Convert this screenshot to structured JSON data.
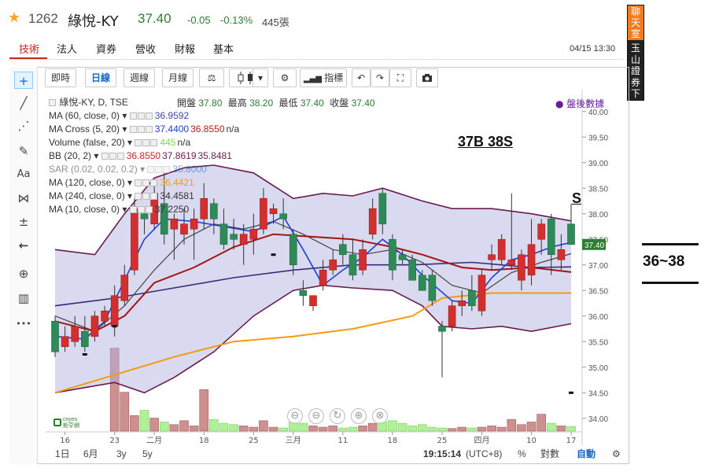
{
  "header": {
    "star": "★",
    "code": "1262",
    "name": "綠悅-KY",
    "price": "37.40",
    "change": "-0.05",
    "change_pct": "-0.13%",
    "volume": "445張"
  },
  "tabs": [
    "技術",
    "法人",
    "資券",
    "營收",
    "財報",
    "基本"
  ],
  "datetime": "04/15 13:30",
  "side_button": {
    "top": "聊天室",
    "bottom": "玉山證券下單"
  },
  "left_tools": [
    "+",
    "╱",
    "⋰",
    "✎",
    "Aa",
    "⋈",
    "±",
    "←",
    "⊕",
    "▥",
    "•••"
  ],
  "toolbar": {
    "intraday": "即時",
    "daily": "日線",
    "weekly": "週線",
    "monthly": "月線",
    "scale_icon": "⚖",
    "candle_icon": "candlestick-icon",
    "dropdown": "▾",
    "gear": "⚙",
    "indicator": "指標",
    "undo": "↶",
    "redo": "↷",
    "fullscreen": "⛶",
    "camera": "camera-icon"
  },
  "ohlc": {
    "open_label": "開盤",
    "open": "37.80",
    "high_label": "最高",
    "high": "38.20",
    "low_label": "最低",
    "low": "37.40",
    "close_label": "收盤",
    "close": "37.40"
  },
  "symbol_line": "綠悅-KY, D, TSE",
  "after_hours": "● 盤後數據",
  "legend": [
    {
      "name": "MA (60, close, 0)",
      "values": [
        "36.9592"
      ],
      "colors": [
        "#3949ab"
      ]
    },
    {
      "name": "MA Cross (5, 20)",
      "values": [
        "37.4400",
        "36.8550",
        "n/a"
      ],
      "colors": [
        "#1e3fd1",
        "#b71c1c",
        "#333333"
      ]
    },
    {
      "name": "Volume (false, 20)",
      "values": [
        "445",
        "n/a"
      ],
      "colors": [
        "#7ed957",
        "#333333"
      ]
    },
    {
      "name": "BB (20, 2)",
      "values": [
        "36.8550",
        "37.8619",
        "35.8481"
      ],
      "colors": [
        "#c62828",
        "#6a1b4d",
        "#6a1b4d"
      ]
    },
    {
      "name": "SAR (0.02, 0.02, 0.2)",
      "values": [
        "35.8000"
      ],
      "colors": [
        "#1565c0"
      ]
    },
    {
      "name": "MA (120, close, 0)",
      "values": [
        "36.4421"
      ],
      "colors": [
        "#f39c12"
      ]
    },
    {
      "name": "MA (240, close, 0)",
      "values": [
        "34.4581"
      ],
      "colors": [
        "#333333"
      ]
    },
    {
      "name": "MA (10, close, 0)",
      "values": [
        "37.2250"
      ],
      "colors": [
        "#333333"
      ]
    }
  ],
  "annotations": {
    "signal": "37B  38S",
    "sell": "S",
    "range": "36~38"
  },
  "zoom_controls": [
    "⊖",
    "⊖",
    "↻",
    "⊕",
    "⊗"
  ],
  "logo_text": "cnyes 鉅亨網",
  "bottom_bar": {
    "ranges": [
      "1日",
      "6月",
      "3y",
      "5y"
    ],
    "time": "19:15:14",
    "tz": "(UTC+8)",
    "pct": "%",
    "log": "對數",
    "auto": "自動",
    "gear": "⚙"
  },
  "chart_data": {
    "type": "candlestick",
    "y_ticks": [
      "40.00",
      "39.50",
      "39.00",
      "38.50",
      "38.00",
      "37.50",
      "37.00",
      "36.50",
      "36.00",
      "35.50",
      "35.00",
      "34.50",
      "34.00"
    ],
    "ylim": [
      33.75,
      40.15
    ],
    "last_price_label": "37.40",
    "x_ticks": [
      {
        "i": 1,
        "label": "16"
      },
      {
        "i": 6,
        "label": "23"
      },
      {
        "i": 10,
        "label": "二月"
      },
      {
        "i": 15,
        "label": "18"
      },
      {
        "i": 20,
        "label": "25"
      },
      {
        "i": 24,
        "label": "三月"
      },
      {
        "i": 29,
        "label": "11"
      },
      {
        "i": 34,
        "label": "18"
      },
      {
        "i": 39,
        "label": "25"
      },
      {
        "i": 43,
        "label": "四月"
      },
      {
        "i": 48,
        "label": "10"
      },
      {
        "i": 52,
        "label": "17"
      }
    ],
    "n_slots": 53,
    "candles": [
      {
        "i": 0,
        "o": 35.9,
        "h": 36.0,
        "l": 35.2,
        "c": 35.3
      },
      {
        "i": 1,
        "o": 35.4,
        "h": 35.8,
        "l": 35.3,
        "c": 35.6
      },
      {
        "i": 2,
        "o": 35.5,
        "h": 36.0,
        "l": 35.4,
        "c": 35.8
      },
      {
        "i": 3,
        "o": 35.7,
        "h": 36.0,
        "l": 35.3,
        "c": 35.4
      },
      {
        "i": 4,
        "o": 35.6,
        "h": 36.1,
        "l": 35.5,
        "c": 36.0
      },
      {
        "i": 5,
        "o": 35.9,
        "h": 36.2,
        "l": 35.8,
        "c": 36.1
      },
      {
        "i": 6,
        "o": 35.8,
        "h": 36.6,
        "l": 35.6,
        "c": 36.4
      },
      {
        "i": 7,
        "o": 36.3,
        "h": 37.0,
        "l": 36.2,
        "c": 36.8
      },
      {
        "i": 8,
        "o": 36.9,
        "h": 38.3,
        "l": 36.8,
        "c": 38.1
      },
      {
        "i": 9,
        "o": 38.0,
        "h": 38.1,
        "l": 37.6,
        "c": 37.9
      },
      {
        "i": 10,
        "o": 37.8,
        "h": 38.6,
        "l": 37.7,
        "c": 38.4
      },
      {
        "i": 11,
        "o": 38.2,
        "h": 38.8,
        "l": 37.4,
        "c": 37.6
      },
      {
        "i": 12,
        "o": 37.7,
        "h": 38.0,
        "l": 37.1,
        "c": 37.9
      },
      {
        "i": 13,
        "o": 37.6,
        "h": 38.1,
        "l": 37.4,
        "c": 37.8
      },
      {
        "i": 14,
        "o": 37.7,
        "h": 38.1,
        "l": 37.1,
        "c": 37.9
      },
      {
        "i": 15,
        "o": 37.9,
        "h": 38.6,
        "l": 37.7,
        "c": 38.3
      },
      {
        "i": 16,
        "o": 38.2,
        "h": 38.3,
        "l": 37.6,
        "c": 37.9
      },
      {
        "i": 17,
        "o": 37.8,
        "h": 38.1,
        "l": 37.3,
        "c": 37.4
      },
      {
        "i": 18,
        "o": 37.6,
        "h": 37.9,
        "l": 37.3,
        "c": 37.5
      },
      {
        "i": 19,
        "o": 37.4,
        "h": 37.8,
        "l": 37.0,
        "c": 37.6
      },
      {
        "i": 20,
        "o": 37.5,
        "h": 38.0,
        "l": 37.2,
        "c": 37.7
      },
      {
        "i": 21,
        "o": 37.7,
        "h": 38.5,
        "l": 37.6,
        "c": 38.3
      },
      {
        "i": 22,
        "o": 38.0,
        "h": 38.2,
        "l": 37.8,
        "c": 38.1
      },
      {
        "i": 23,
        "o": 38.0,
        "h": 38.3,
        "l": 37.7,
        "c": 37.9
      },
      {
        "i": 24,
        "o": 37.6,
        "h": 37.7,
        "l": 36.8,
        "c": 37.0
      },
      {
        "i": 25,
        "o": 36.5,
        "h": 36.7,
        "l": 36.2,
        "c": 36.4
      },
      {
        "i": 26,
        "o": 36.2,
        "h": 36.3,
        "l": 36.1,
        "c": 36.4
      },
      {
        "i": 27,
        "o": 36.6,
        "h": 37.1,
        "l": 36.5,
        "c": 36.9
      },
      {
        "i": 28,
        "o": 36.9,
        "h": 37.3,
        "l": 36.8,
        "c": 37.1
      },
      {
        "i": 29,
        "o": 37.4,
        "h": 37.6,
        "l": 37.0,
        "c": 37.2
      },
      {
        "i": 30,
        "o": 37.2,
        "h": 37.5,
        "l": 36.7,
        "c": 36.8
      },
      {
        "i": 31,
        "o": 36.9,
        "h": 37.5,
        "l": 36.8,
        "c": 37.3
      },
      {
        "i": 32,
        "o": 37.6,
        "h": 38.3,
        "l": 37.5,
        "c": 38.1
      },
      {
        "i": 33,
        "o": 38.4,
        "h": 38.5,
        "l": 37.6,
        "c": 37.8
      },
      {
        "i": 34,
        "o": 37.5,
        "h": 37.6,
        "l": 36.7,
        "c": 36.9
      },
      {
        "i": 35,
        "o": 37.2,
        "h": 37.3,
        "l": 37.0,
        "c": 37.1
      },
      {
        "i": 36,
        "o": 37.1,
        "h": 37.2,
        "l": 36.7,
        "c": 36.7
      },
      {
        "i": 37,
        "o": 36.8,
        "h": 36.9,
        "l": 36.5,
        "c": 36.5
      },
      {
        "i": 38,
        "o": 36.8,
        "h": 36.9,
        "l": 36.2,
        "c": 36.3
      },
      {
        "i": 39,
        "o": 35.8,
        "h": 35.9,
        "l": 34.8,
        "c": 35.7
      },
      {
        "i": 40,
        "o": 35.8,
        "h": 36.3,
        "l": 35.7,
        "c": 36.2
      },
      {
        "i": 41,
        "o": 36.2,
        "h": 36.5,
        "l": 36.0,
        "c": 36.3
      },
      {
        "i": 42,
        "o": 36.5,
        "h": 36.8,
        "l": 36.1,
        "c": 36.2
      },
      {
        "i": 43,
        "o": 36.1,
        "h": 36.9,
        "l": 36.0,
        "c": 36.8
      },
      {
        "i": 44,
        "o": 37.1,
        "h": 37.4,
        "l": 36.9,
        "c": 37.2
      },
      {
        "i": 45,
        "o": 37.1,
        "h": 37.6,
        "l": 37.0,
        "c": 37.5
      },
      {
        "i": 46,
        "o": 37.0,
        "h": 38.4,
        "l": 36.9,
        "c": 37.1
      },
      {
        "i": 47,
        "o": 36.7,
        "h": 37.3,
        "l": 36.5,
        "c": 37.2
      },
      {
        "i": 48,
        "o": 36.8,
        "h": 37.9,
        "l": 36.6,
        "c": 37.4
      },
      {
        "i": 49,
        "o": 37.5,
        "h": 37.9,
        "l": 37.2,
        "c": 37.8
      },
      {
        "i": 50,
        "o": 37.9,
        "h": 38.0,
        "l": 36.8,
        "c": 37.2
      },
      {
        "i": 51,
        "o": 37.1,
        "h": 37.6,
        "l": 36.9,
        "c": 37.3
      },
      {
        "i": 52,
        "o": 37.8,
        "h": 38.2,
        "l": 37.4,
        "c": 37.4
      }
    ],
    "volume": [
      0,
      0,
      0,
      0,
      0,
      0,
      3200,
      1500,
      600,
      800,
      500,
      350,
      250,
      400,
      200,
      1600,
      450,
      300,
      250,
      200,
      150,
      400,
      150,
      120,
      350,
      300,
      200,
      150,
      200,
      120,
      150,
      200,
      300,
      350,
      400,
      300,
      200,
      250,
      150,
      120,
      100,
      150,
      120,
      150,
      200,
      150,
      450,
      250,
      350,
      650,
      300,
      200,
      180
    ],
    "volume_max": 3400,
    "ma120": [
      [
        0,
        34.5
      ],
      [
        6,
        34.85
      ],
      [
        12,
        35.2
      ],
      [
        18,
        35.5
      ],
      [
        24,
        35.6
      ],
      [
        30,
        35.75
      ],
      [
        36,
        36.0
      ],
      [
        39,
        36.35
      ],
      [
        44,
        36.45
      ],
      [
        52,
        36.45
      ]
    ],
    "ma240_last": 34.4581,
    "ma60": [
      [
        0,
        36.2
      ],
      [
        6,
        36.35
      ],
      [
        12,
        36.55
      ],
      [
        18,
        36.75
      ],
      [
        24,
        36.9
      ],
      [
        30,
        37.0
      ],
      [
        36,
        37.0
      ],
      [
        42,
        37.05
      ],
      [
        48,
        36.95
      ],
      [
        52,
        36.96
      ]
    ],
    "ma20": [
      [
        0,
        35.9
      ],
      [
        4,
        35.7
      ],
      [
        7,
        36.0
      ],
      [
        10,
        36.65
      ],
      [
        14,
        36.95
      ],
      [
        18,
        37.35
      ],
      [
        22,
        37.6
      ],
      [
        26,
        37.55
      ],
      [
        30,
        37.5
      ],
      [
        34,
        37.35
      ],
      [
        37,
        37.2
      ],
      [
        41,
        36.95
      ],
      [
        44,
        36.9
      ],
      [
        48,
        36.95
      ],
      [
        52,
        36.86
      ]
    ],
    "ma5": [
      [
        0,
        35.6
      ],
      [
        3,
        35.55
      ],
      [
        5,
        35.9
      ],
      [
        7,
        36.7
      ],
      [
        9,
        37.5
      ],
      [
        11,
        37.9
      ],
      [
        14,
        37.85
      ],
      [
        17,
        37.75
      ],
      [
        20,
        37.65
      ],
      [
        23,
        37.95
      ],
      [
        25,
        37.3
      ],
      [
        27,
        36.6
      ],
      [
        29,
        36.9
      ],
      [
        31,
        37.15
      ],
      [
        33,
        37.5
      ],
      [
        35,
        37.2
      ],
      [
        37,
        36.8
      ],
      [
        40,
        36.3
      ],
      [
        42,
        36.25
      ],
      [
        44,
        36.75
      ],
      [
        46,
        37.1
      ],
      [
        48,
        37.2
      ],
      [
        50,
        37.35
      ],
      [
        52,
        37.44
      ]
    ],
    "ma10": [
      [
        0,
        36.0
      ],
      [
        4,
        35.7
      ],
      [
        7,
        36.2
      ],
      [
        10,
        36.9
      ],
      [
        13,
        37.5
      ],
      [
        16,
        37.8
      ],
      [
        19,
        37.7
      ],
      [
        22,
        37.85
      ],
      [
        25,
        37.6
      ],
      [
        28,
        37.3
      ],
      [
        31,
        37.2
      ],
      [
        34,
        37.3
      ],
      [
        37,
        37.05
      ],
      [
        40,
        36.6
      ],
      [
        43,
        36.45
      ],
      [
        46,
        36.85
      ],
      [
        49,
        37.05
      ],
      [
        52,
        37.22
      ]
    ],
    "bb_upper": [
      [
        0,
        37.3
      ],
      [
        4,
        37.2
      ],
      [
        7,
        38.0
      ],
      [
        10,
        38.7
      ],
      [
        13,
        38.9
      ],
      [
        16,
        38.95
      ],
      [
        20,
        38.8
      ],
      [
        24,
        38.3
      ],
      [
        27,
        38.4
      ],
      [
        30,
        38.35
      ],
      [
        33,
        38.5
      ],
      [
        37,
        38.25
      ],
      [
        40,
        38.1
      ],
      [
        44,
        38.1
      ],
      [
        48,
        38.0
      ],
      [
        52,
        37.86
      ]
    ],
    "bb_lower": [
      [
        0,
        34.5
      ],
      [
        3,
        34.6
      ],
      [
        6,
        34.7
      ],
      [
        9,
        34.5
      ],
      [
        12,
        34.8
      ],
      [
        16,
        35.3
      ],
      [
        20,
        36.0
      ],
      [
        24,
        36.5
      ],
      [
        27,
        36.6
      ],
      [
        30,
        36.55
      ],
      [
        34,
        36.5
      ],
      [
        37,
        36.2
      ],
      [
        39,
        35.8
      ],
      [
        42,
        35.75
      ],
      [
        45,
        35.8
      ],
      [
        48,
        35.7
      ],
      [
        52,
        35.85
      ]
    ],
    "sar_points": [
      [
        3,
        35.25
      ],
      [
        6,
        35.8
      ],
      [
        22,
        37.2
      ],
      [
        52,
        34.5
      ]
    ]
  }
}
